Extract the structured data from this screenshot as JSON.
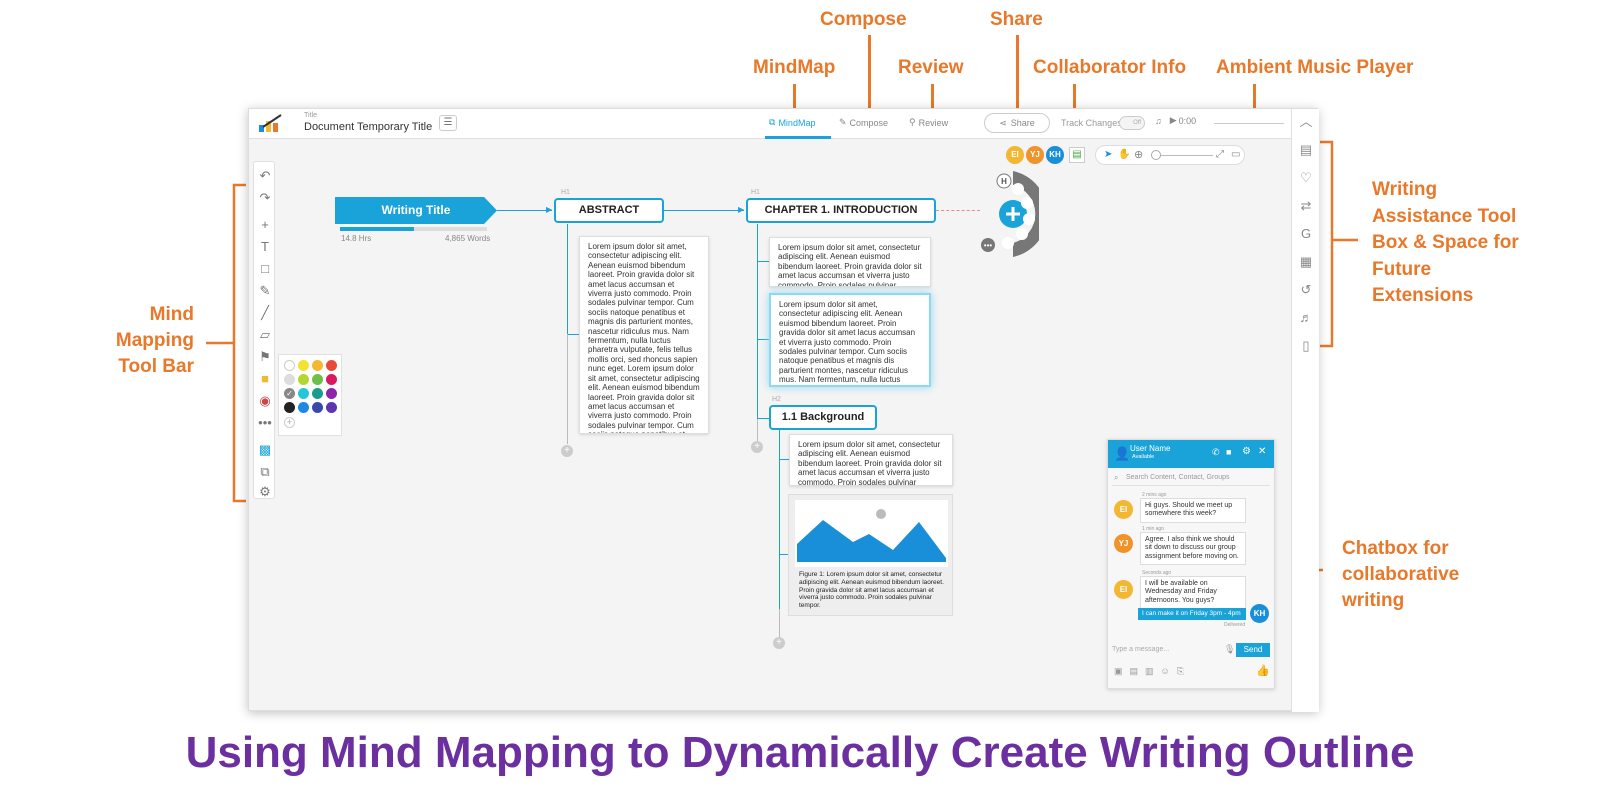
{
  "callouts": {
    "mindmap": "MindMap",
    "compose": "Compose",
    "review": "Review",
    "share": "Share",
    "collaborator": "Collaborator Info",
    "music": "Ambient Music Player",
    "writing_tool": [
      "Writing",
      "Assistance Tool",
      "Box & Space for",
      "Future",
      "Extensions"
    ],
    "mindmap_toolbar": [
      "Mind",
      "Mapping",
      "Tool Bar"
    ],
    "chatbox": [
      "Chatbox for",
      "collaborative",
      "writing"
    ]
  },
  "caption": "Using Mind Mapping to Dynamically Create Writing Outline",
  "app": {
    "title_label": "Title",
    "title": "Document Temporary Title",
    "tabs": {
      "mindmap": "MindMap",
      "compose": "Compose",
      "review": "Review"
    },
    "share": "Share",
    "track_changes": "Track Changes",
    "toggle": "Off",
    "music_time": "0:00",
    "avatars": [
      "EI",
      "YJ",
      "KH"
    ]
  },
  "mindmap": {
    "root": {
      "title": "Writing Title",
      "hours": "14.8 Hrs",
      "words": "4,865 Words",
      "progress": 0.5
    },
    "abstract": {
      "label": "ABSTRACT",
      "level": "H1",
      "text": "Lorem ipsum dolor sit amet, consectetur adipiscing elit. Aenean euismod bibendum laoreet. Proin gravida dolor sit amet lacus accumsan et viverra justo commodo. Proin sodales pulvinar tempor. Cum sociis natoque penatibus et magnis dis parturient montes, nascetur ridiculus mus. Nam fermentum, nulla luctus pharetra vulputate, felis tellus mollis orci, sed rhoncus sapien nunc eget. Lorem ipsum dolor sit amet, consectetur adipiscing elit. Aenean euismod bibendum laoreet. Proin gravida dolor sit amet lacus accumsan et viverra justo commodo. Proin sodales pulvinar tempor. Cum sociis natoque penatibus et magnis dis parturient montes, nascetur ridiculus mus. Nam"
    },
    "chapter1": {
      "label": "CHAPTER 1. INTRODUCTION",
      "level": "H1",
      "card1": "Lorem ipsum dolor sit amet, consectetur adipiscing elit. Aenean euismod bibendum laoreet. Proin gravida dolor sit amet lacus accumsan et viverra justo commodo. Proin sodales pulvinar tempor.",
      "card2": "Lorem ipsum dolor sit amet, consectetur adipiscing elit. Aenean euismod bibendum laoreet. Proin gravida dolor sit amet lacus accumsan et viverra justo commodo. Proin sodales pulvinar tempor. Cum sociis natoque penatibus et magnis dis parturient montes, nascetur ridiculus mus. Nam fermentum, nulla luctus pharetra vulputate, felis tellus mollis orci, sed rhoncus sapien nunc eget. Lorem ipsum dolor sit amet."
    },
    "background": {
      "label": "1.1 Background",
      "level": "H2",
      "card": "Lorem ipsum dolor sit amet, consectetur adipiscing elit. Aenean euismod bibendum laoreet. Proin gravida dolor sit amet lacus accumsan et viverra justo commodo. Proin sodales pulvinar tempor.",
      "figure_caption": "Figure 1: Lorem ipsum dolor sit amet, consectetur adipiscing elit. Aenean euismod bibendum laoreet. Proin gravida dolor sit amet lacus accumsan et viverra justo commodo. Proin sodales pulvinar tempor."
    }
  },
  "chat": {
    "user": "User Name",
    "status": "Available",
    "search_placeholder": "Search Content, Contact, Groups",
    "messages": [
      {
        "who": "EI",
        "time": "2 mins ago",
        "text": "Hi guys. Should we meet up somewhere this week?"
      },
      {
        "who": "YJ",
        "time": "1 min ago",
        "text": "Agree. I also think we should sit down to discuss our group assignment before moving on."
      },
      {
        "who": "EI",
        "time": "Seconds ago",
        "text": "I will be available on Wednesday and Friday afternoons. You guys?"
      }
    ],
    "own_message": "I can make it on Friday 3pm - 4pm",
    "own_avatar": "KH",
    "delivered": "Delivered",
    "input_placeholder": "Type a message...",
    "send": "Send"
  },
  "colors": {
    "accent": "#1aa3d9",
    "callout": "#e8782a",
    "caption": "#6b2fa0",
    "avatar_ei": "#f4b731",
    "avatar_yj": "#f0932b",
    "avatar_kh": "#1a8fd9"
  }
}
